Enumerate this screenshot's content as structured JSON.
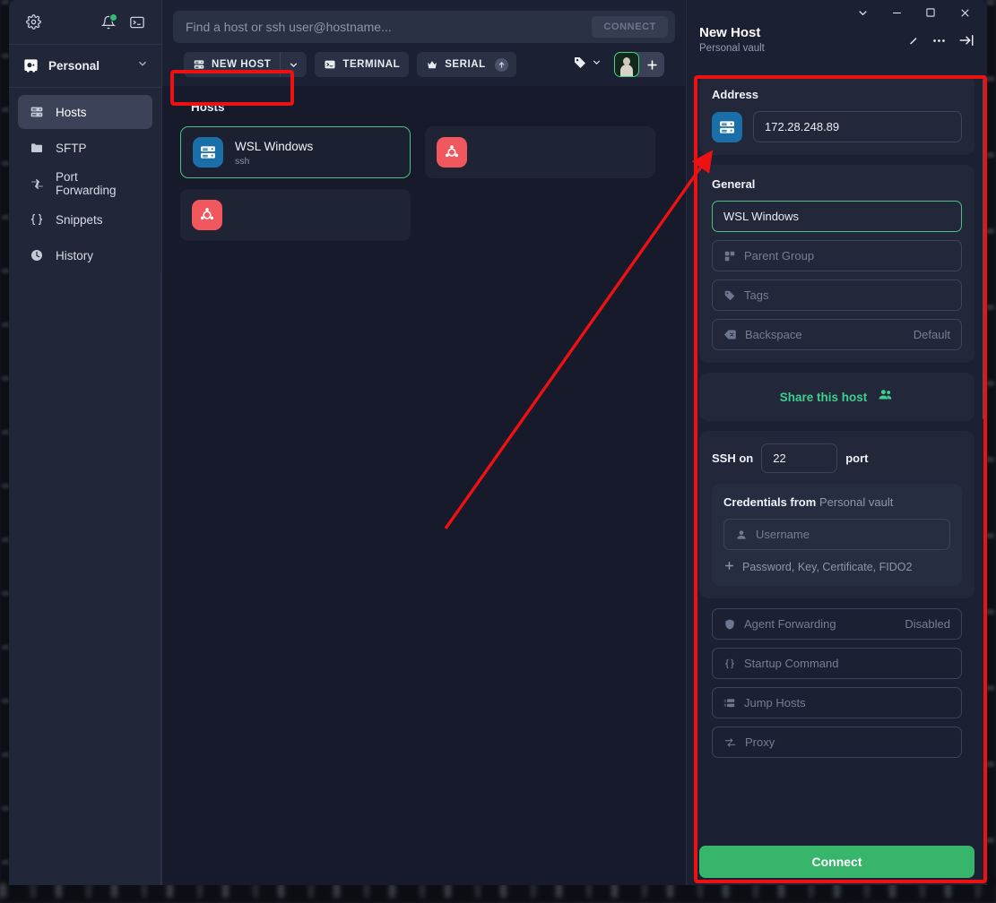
{
  "sidebar": {
    "top_icons": [
      {
        "name": "settings-gear-icon",
        "label": "Settings"
      },
      {
        "name": "notifications-bell-icon",
        "label": "Notifications"
      },
      {
        "name": "terminal-icon",
        "label": "Terminal"
      }
    ],
    "vault": {
      "label": "Personal",
      "icon": "vault-icon",
      "chevron": "chevron-down-icon"
    },
    "items": [
      {
        "label": "Hosts",
        "icon": "server-icon",
        "active": true
      },
      {
        "label": "SFTP",
        "icon": "folder-icon",
        "active": false
      },
      {
        "label": "Port Forwarding",
        "icon": "port-forwarding-icon",
        "active": false
      },
      {
        "label": "Snippets",
        "icon": "braces-icon",
        "active": false
      },
      {
        "label": "History",
        "icon": "clock-icon",
        "active": false
      }
    ]
  },
  "search": {
    "placeholder": "Find a host or ssh user@hostname...",
    "connect_label": "CONNECT"
  },
  "toolbar": {
    "new_host_label": "NEW HOST",
    "terminal_label": "TERMINAL",
    "serial_label": "SERIAL",
    "serial_badge": "upgrade-arrow-icon",
    "tag_icon": "tag-icon",
    "plus_label": "+"
  },
  "main": {
    "section_title": "Hosts",
    "hosts": [
      {
        "name": "WSL Windows",
        "protocol": "ssh",
        "icon": "server-icon",
        "icon_color": "#1a6fa8",
        "selected": true
      },
      {
        "name": "",
        "protocol": "",
        "icon": "ubuntu-icon",
        "icon_color": "#f0585e",
        "selected": false
      },
      {
        "name": "",
        "protocol": "",
        "icon": "ubuntu-icon",
        "icon_color": "#f0585e",
        "selected": false
      }
    ]
  },
  "panel": {
    "title": "New Host",
    "subtitle": "Personal vault",
    "window_controls": [
      "chevron-down-icon",
      "minimize-icon",
      "maximize-icon",
      "close-icon"
    ],
    "actions": [
      "pin-icon",
      "more-horizontal-icon",
      "collapse-right-icon"
    ],
    "address": {
      "label": "Address",
      "icon": "server-icon",
      "value": "172.28.248.89"
    },
    "general": {
      "label": "General",
      "name_value": "WSL Windows",
      "parent_group_placeholder": "Parent Group",
      "tags_placeholder": "Tags",
      "backspace_placeholder": "Backspace",
      "backspace_value": "Default"
    },
    "share": {
      "label": "Share this host",
      "icon": "people-icon"
    },
    "ssh": {
      "prefix": "SSH on",
      "port": "22",
      "suffix": "port"
    },
    "credentials": {
      "label": "Credentials from",
      "vault": "Personal vault",
      "username_placeholder": "Username",
      "add_label": "Password, Key, Certificate, FIDO2"
    },
    "advanced": [
      {
        "label": "Agent Forwarding",
        "value": "Disabled",
        "icon": "shield-icon"
      },
      {
        "label": "Startup Command",
        "value": "",
        "icon": "braces-icon"
      },
      {
        "label": "Jump Hosts",
        "value": "",
        "icon": "jump-hosts-icon"
      },
      {
        "label": "Proxy",
        "value": "",
        "icon": "proxy-icon"
      }
    ],
    "connect_label": "Connect"
  },
  "annotations": {
    "accent_color": "#ee1111",
    "highlight_new_host": true,
    "highlight_panel": true,
    "arrow_from_to": "points from main area to Address field"
  }
}
